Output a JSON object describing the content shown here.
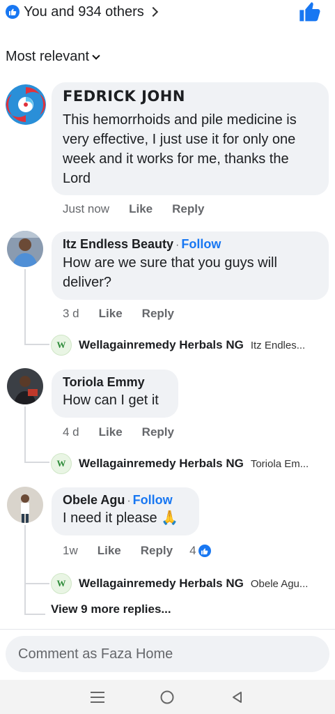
{
  "header": {
    "reactions_text": "You and 934 others",
    "like_icon": "like-icon"
  },
  "sort": {
    "label": "Most relevant"
  },
  "comments": [
    {
      "author": "FEDRICK JOHN",
      "text": "This hemorrhoids and pile medicine is very effective, I just use it for only one week and it works for me, thanks the Lord",
      "time": "Just now",
      "like": "Like",
      "reply": "Reply"
    },
    {
      "author": "Itz Endless Beauty",
      "follow": "Follow",
      "dot": "·",
      "text": "How are we sure that you guys will deliver?",
      "time": "3 d",
      "like": "Like",
      "reply": "Reply",
      "reply_preview": {
        "name": "Wellagainremedy Herbals NG",
        "preview": "Itz Endles..."
      }
    },
    {
      "author": "Toriola Emmy",
      "text": "How can I get it",
      "time": "4 d",
      "like": "Like",
      "reply": "Reply",
      "reply_preview": {
        "name": "Wellagainremedy Herbals NG",
        "preview": "Toriola Em..."
      }
    },
    {
      "author": "Obele Agu",
      "follow": "Follow",
      "dot": "·",
      "text": "I need it please 🙏",
      "time": "1w",
      "like": "Like",
      "reply": "Reply",
      "reaction_count": "4",
      "reply_preview": {
        "name": "Wellagainremedy Herbals NG",
        "preview": "Obele Agu..."
      },
      "view_more": "View 9 more replies..."
    }
  ],
  "composer": {
    "placeholder": "Comment as Faza Home"
  },
  "colors": {
    "accent": "#1877f2",
    "bubble": "#f0f2f5",
    "meta": "#65676b"
  },
  "nav": {
    "icons": [
      "menu-icon",
      "home-circle-icon",
      "back-triangle-icon"
    ]
  }
}
